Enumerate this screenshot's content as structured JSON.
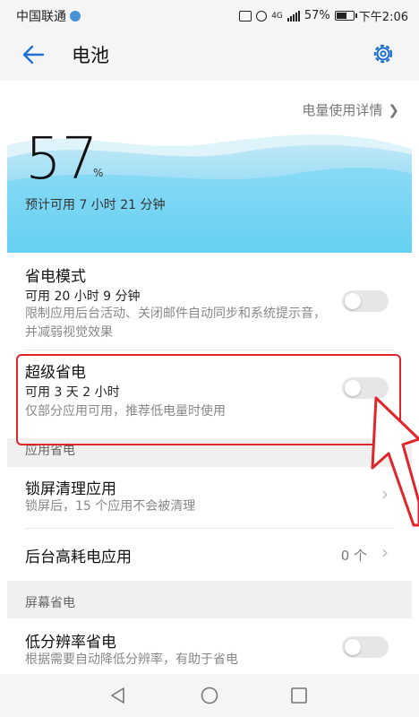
{
  "status": {
    "carrier": "中国联通",
    "battery_pct": "57%",
    "time": "下午2:06",
    "network": "4G"
  },
  "header": {
    "title": "电池"
  },
  "battery": {
    "detail_link": "电量使用详情",
    "percent": "57",
    "percent_sign": "%",
    "remaining": "预计可用 7 小时 21 分钟"
  },
  "power_save": {
    "title": "省电模式",
    "sub": "可用 20 小时 9 分钟",
    "desc": "限制应用后台活动、关闭邮件自动同步和系统提示音，并减弱视觉效果",
    "enabled": false
  },
  "ultra_save": {
    "title": "超级省电",
    "sub": "可用 3 天 2 小时",
    "desc": "仅部分应用可用，推荐低电量时使用",
    "enabled": false
  },
  "section_app": {
    "label": "应用省电"
  },
  "lockscreen_clean": {
    "title": "锁屏清理应用",
    "sub": "锁屏后，15 个应用不会被清理"
  },
  "bg_high_power": {
    "title": "后台高耗电应用",
    "count": "0 个"
  },
  "section_screen": {
    "label": "屏幕省电"
  },
  "low_res": {
    "title": "低分辨率省电",
    "sub": "根据需要自动降低分辨率，有助于省电",
    "enabled": false
  },
  "colors": {
    "accent": "#1f6fd1",
    "wave": "#6dd3f2",
    "highlight": "#e0262b"
  }
}
